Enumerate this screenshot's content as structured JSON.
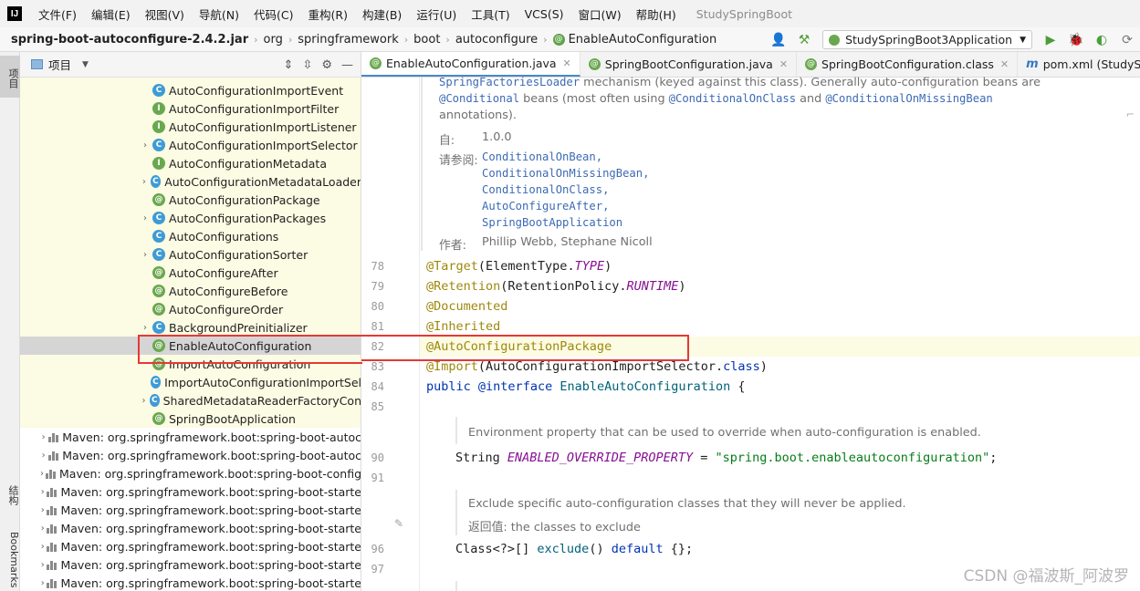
{
  "menubar": {
    "logo": "IJ",
    "items": [
      "文件(F)",
      "编辑(E)",
      "视图(V)",
      "导航(N)",
      "代码(C)",
      "重构(R)",
      "构建(B)",
      "运行(U)",
      "工具(T)",
      "VCS(S)",
      "窗口(W)",
      "帮助(H)"
    ],
    "window_title": "StudySpringBoot"
  },
  "breadcrumb": {
    "jar": "spring-boot-autoconfigure-2.4.2.jar",
    "parts": [
      "org",
      "springframework",
      "boot",
      "autoconfigure"
    ],
    "current": "EnableAutoConfiguration"
  },
  "run_config": {
    "label": "StudySpringBoot3Application"
  },
  "toolstrip": {
    "project_tab": "项目",
    "structure_tab": "结构",
    "bookmarks_tab": "Bookmarks"
  },
  "project_panel": {
    "title": "项目",
    "rows": [
      {
        "label": "AutoConfigurationImportEvent",
        "icon": "C",
        "kind": "c",
        "expand": ""
      },
      {
        "label": "AutoConfigurationImportFilter",
        "icon": "I",
        "kind": "i",
        "expand": ""
      },
      {
        "label": "AutoConfigurationImportListener",
        "icon": "I",
        "kind": "i",
        "expand": ""
      },
      {
        "label": "AutoConfigurationImportSelector",
        "icon": "C",
        "kind": "c",
        "expand": "›"
      },
      {
        "label": "AutoConfigurationMetadata",
        "icon": "I",
        "kind": "i",
        "expand": ""
      },
      {
        "label": "AutoConfigurationMetadataLoader",
        "icon": "C",
        "kind": "c",
        "expand": "›"
      },
      {
        "label": "AutoConfigurationPackage",
        "icon": "@",
        "kind": "a",
        "expand": ""
      },
      {
        "label": "AutoConfigurationPackages",
        "icon": "C",
        "kind": "c",
        "expand": "›"
      },
      {
        "label": "AutoConfigurations",
        "icon": "C",
        "kind": "c",
        "expand": ""
      },
      {
        "label": "AutoConfigurationSorter",
        "icon": "C",
        "kind": "c",
        "expand": "›"
      },
      {
        "label": "AutoConfigureAfter",
        "icon": "@",
        "kind": "a",
        "expand": ""
      },
      {
        "label": "AutoConfigureBefore",
        "icon": "@",
        "kind": "a",
        "expand": ""
      },
      {
        "label": "AutoConfigureOrder",
        "icon": "@",
        "kind": "a",
        "expand": ""
      },
      {
        "label": "BackgroundPreinitializer",
        "icon": "C",
        "kind": "c",
        "expand": "›"
      },
      {
        "label": "EnableAutoConfiguration",
        "icon": "@",
        "kind": "a",
        "expand": "",
        "selected": true
      },
      {
        "label": "ImportAutoConfiguration",
        "icon": "@",
        "kind": "a",
        "expand": ""
      },
      {
        "label": "ImportAutoConfigurationImportSel",
        "icon": "C",
        "kind": "c",
        "expand": ""
      },
      {
        "label": "SharedMetadataReaderFactoryCon",
        "icon": "C",
        "kind": "c",
        "expand": "›"
      },
      {
        "label": "SpringBootApplication",
        "icon": "@",
        "kind": "a",
        "expand": ""
      }
    ],
    "maven_rows": [
      "Maven: org.springframework.boot:spring-boot-autoc",
      "Maven: org.springframework.boot:spring-boot-autoc",
      "Maven: org.springframework.boot:spring-boot-config",
      "Maven: org.springframework.boot:spring-boot-starte",
      "Maven: org.springframework.boot:spring-boot-starte",
      "Maven: org.springframework.boot:spring-boot-starte",
      "Maven: org.springframework.boot:spring-boot-starte",
      "Maven: org.springframework.boot:spring-boot-starte",
      "Maven: org.springframework.boot:spring-boot-starte"
    ]
  },
  "tabs": [
    {
      "label": "EnableAutoConfiguration.java",
      "icon": "@",
      "active": true
    },
    {
      "label": "SpringBootConfiguration.java",
      "icon": "@",
      "active": false
    },
    {
      "label": "SpringBootConfiguration.class",
      "icon": "@",
      "active": false
    },
    {
      "label": "pom.xml (StudySpringBoot",
      "icon": "m",
      "active": false
    }
  ],
  "doc1": {
    "line1_code": "SpringFactoriesLoader",
    "line1_text": " mechanism (keyed against this class). Generally auto-configuration beans are",
    "line2_code1": "@Conditional",
    "line2_text1": " beans (most often using ",
    "line2_code2": "@ConditionalOnClass",
    "line2_text2": " and ",
    "line2_code3": "@ConditionalOnMissingBean",
    "line3": "annotations).",
    "since_label": "自:",
    "since_value": "1.0.0",
    "see_label": "请参阅:",
    "see_items": [
      "ConditionalOnBean,",
      "ConditionalOnMissingBean,",
      "ConditionalOnClass,",
      "AutoConfigureAfter,",
      "SpringBootApplication"
    ],
    "author_label": "作者:",
    "author_value": "Phillip Webb, Stephane Nicoll"
  },
  "code": {
    "l78": {
      "num": "78",
      "ann": "@Target",
      "rest1": "(ElementType.",
      "const": "TYPE",
      "rest2": ")"
    },
    "l79": {
      "num": "79",
      "ann": "@Retention",
      "rest1": "(RetentionPolicy.",
      "const": "RUNTIME",
      "rest2": ")"
    },
    "l80": {
      "num": "80",
      "ann": "@Documented"
    },
    "l81": {
      "num": "81",
      "ann": "@Inherited"
    },
    "l82": {
      "num": "82",
      "ann": "@AutoConfigurationPackage"
    },
    "l83": {
      "num": "83",
      "ann": "@Import",
      "rest1": "(AutoConfigurationImportSelector.",
      "kw": "class",
      "rest2": ")"
    },
    "l84": {
      "num": "84",
      "kw1": "public",
      "kw2": "@interface",
      "name": "EnableAutoConfiguration",
      "rest": " {"
    },
    "l85": {
      "num": "85"
    },
    "doc2": "Environment property that can be used to override when auto-configuration is enabled.",
    "l90": {
      "num": "90",
      "type": "String ",
      "const": "ENABLED_OVERRIDE_PROPERTY",
      "eq": " = ",
      "str": "\"spring.boot.enableautoconfiguration\"",
      "end": ";"
    },
    "l91": {
      "num": "91"
    },
    "doc3_line1": "Exclude specific auto-configuration classes that they will never be applied.",
    "doc3_ret_label": "返回值:",
    "doc3_ret_value": " the classes to exclude",
    "l96": {
      "num": "96",
      "type": "Class<?>[] ",
      "fn": "exclude",
      "paren": "() ",
      "kw": "default",
      "rest": " {};"
    },
    "l97": {
      "num": "97"
    }
  },
  "watermark": "CSDN @福波斯_阿波罗"
}
